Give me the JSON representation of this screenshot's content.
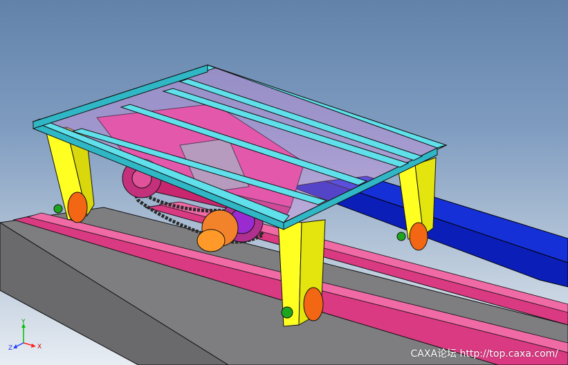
{
  "viewport": {
    "watermark": "CAXA论坛 http://top.caxa.com/"
  },
  "axis_triad": {
    "x_label": "X",
    "y_label": "Y",
    "z_label": "Z"
  },
  "colors": {
    "frame": "#5fe0ea",
    "legs": "#ffff22",
    "rails": "#e0307d",
    "base": "#8b8b8b",
    "rack": "#0b1fb8",
    "wheels": "#f26614",
    "body": "#e63c8c",
    "hub": "#ff9a2a"
  }
}
